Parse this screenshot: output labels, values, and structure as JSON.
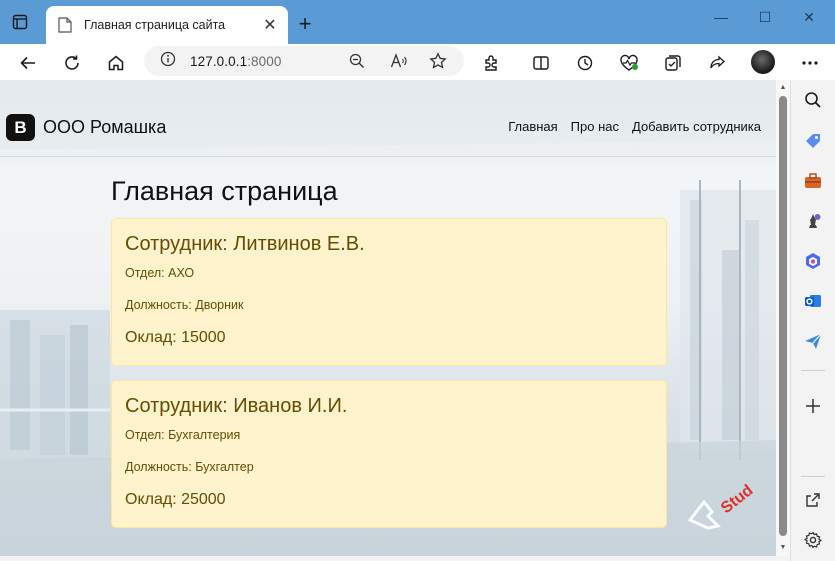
{
  "browser": {
    "tab_title": "Главная страница сайта",
    "address": {
      "host": "127.0.0.1",
      "port": ":8000"
    },
    "tab_close_glyph": "✕",
    "new_tab_glyph": "+",
    "window_controls": {
      "minimize": "—",
      "maximize": "☐",
      "close": "✕"
    }
  },
  "site": {
    "brand_logo": "B",
    "brand_name": "ООО Ромашка",
    "nav": [
      "Главная",
      "Про нас",
      "Добавить сотрудника"
    ],
    "page_title": "Главная страница",
    "employees": [
      {
        "title": "Сотрудник: Литвинов Е.В.",
        "department": "Отдел: АХО",
        "position": "Должность: Дворник",
        "salary": "Оклад: 15000"
      },
      {
        "title": "Сотрудник: Иванов И.И.",
        "department": "Отдел: Бухгалтерия",
        "position": "Должность: Бухгалтер",
        "salary": "Оклад: 25000"
      }
    ],
    "watermark": "Stud"
  },
  "colors": {
    "titlebar": "#5b9bd5",
    "card_bg": "#fff3cd",
    "card_border": "#ffe69c",
    "card_text": "#664d03"
  },
  "icons": {
    "toolbar": [
      "back-icon",
      "refresh-icon",
      "home-icon",
      "info-icon",
      "zoom-icon",
      "read-aloud-icon",
      "favorite-icon",
      "extensions-icon",
      "split-screen-icon",
      "history-icon",
      "performance-icon",
      "collections-icon",
      "share-icon",
      "profile-icon",
      "more-icon"
    ],
    "sidebar": [
      "search-icon",
      "tag-icon",
      "toolbox-icon",
      "chess-icon",
      "copilot-icon",
      "outlook-icon",
      "send-icon",
      "add-icon",
      "open-external-icon",
      "settings-icon"
    ]
  }
}
